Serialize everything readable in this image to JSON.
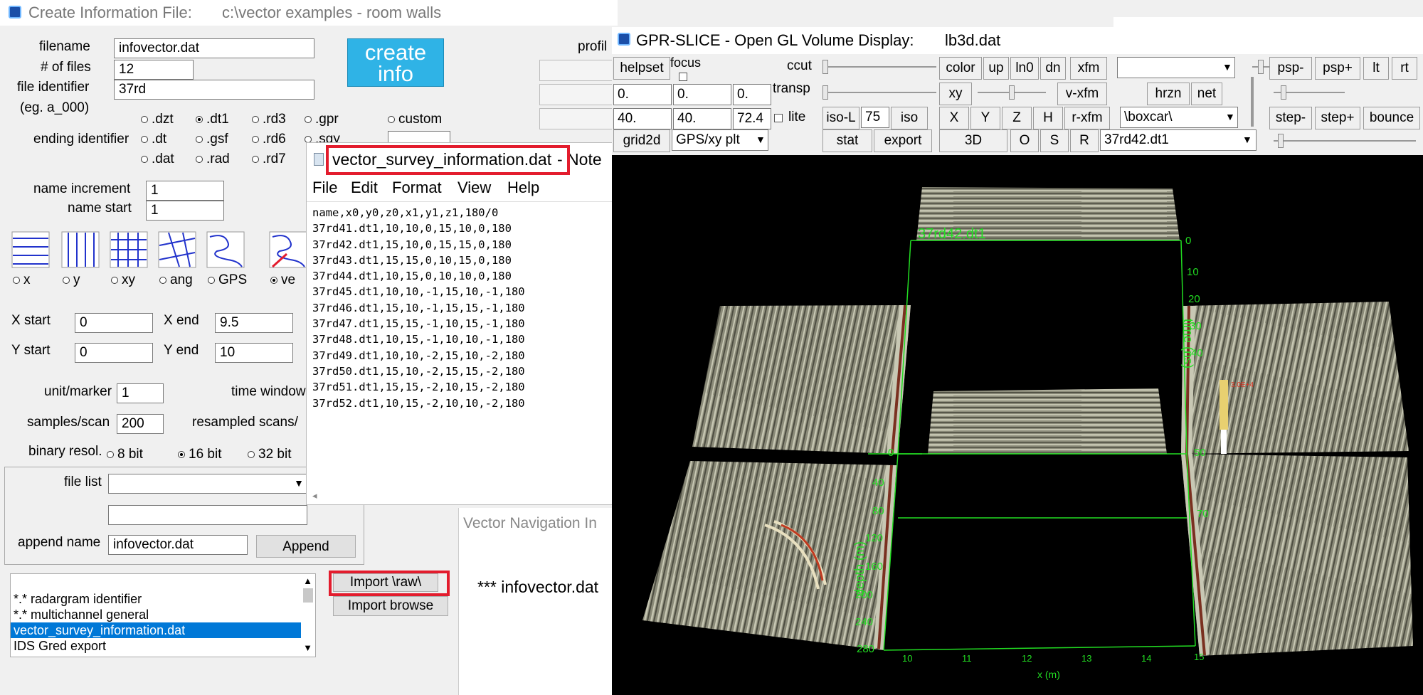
{
  "left_window": {
    "title": "Create Information File:",
    "title_path": "c:\\vector examples - room walls",
    "filename_label": "filename",
    "filename_value": "infovector.dat",
    "num_files_label": "# of files",
    "num_files_value": "12",
    "file_identifier_label": "file identifier",
    "file_identifier_value": "37rd",
    "eg_label": "(eg. a_000)",
    "create_info_label_1": "create",
    "create_info_label_2": "info",
    "profile_label": "profil",
    "ending_identifier_label": "ending identifier",
    "ext_row1": [
      ".dzt",
      ".dt1",
      ".rd3",
      ".gpr",
      "custom"
    ],
    "ext_row2": [
      ".dt",
      ".gsf",
      ".rd6",
      ".sgy"
    ],
    "ext_row3": [
      ".dat",
      ".rad",
      ".rd7"
    ],
    "name_increment_label": "name increment",
    "name_increment_value": "1",
    "name_start_label": "name start",
    "name_start_value": "1",
    "grid_options": [
      "x",
      "y",
      "xy",
      "ang",
      "GPS",
      "ve"
    ],
    "x_start_label": "X start",
    "x_start_value": "0",
    "x_end_label": "X end",
    "x_end_value": "9.5",
    "y_start_label": "Y start",
    "y_start_value": "0",
    "y_end_label": "Y end",
    "y_end_value": "10",
    "unit_marker_label": "unit/marker",
    "unit_marker_value": "1",
    "time_window_label": "time window",
    "samples_scan_label": "samples/scan",
    "samples_scan_value": "200",
    "resampled_label": "resampled scans/",
    "binary_resol_label": "binary resol.",
    "binary_options": [
      "8 bit",
      "16 bit",
      "32 bit"
    ],
    "file_list_label": "file list",
    "append_name_label": "append name",
    "append_name_value": "infovector.dat",
    "append_button": "Append",
    "import_raw_button": "Import \\raw\\",
    "import_browse_button": "Import browse",
    "list_items": [
      "*.* radargram identifier",
      "*.* multichannel general",
      "vector_survey_information.dat",
      "IDS Gred export"
    ],
    "selected_list_index": 2,
    "vector_nav_title": "Vector Navigation In",
    "vector_nav_text": "*** infovector.dat"
  },
  "notepad": {
    "title": "vector_survey_information.dat",
    "title_suffix": "- Note",
    "menu": [
      "File",
      "Edit",
      "Format",
      "View",
      "Help"
    ],
    "lines": [
      "name,x0,y0,z0,x1,y1,z1,180/0",
      "37rd41.dt1,10,10,0,15,10,0,180",
      "37rd42.dt1,15,10,0,15,15,0,180",
      "37rd43.dt1,15,15,0,10,15,0,180",
      "37rd44.dt1,10,15,0,10,10,0,180",
      "37rd45.dt1,10,10,-1,15,10,-1,180",
      "37rd46.dt1,15,10,-1,15,15,-1,180",
      "37rd47.dt1,15,15,-1,10,15,-1,180",
      "37rd48.dt1,10,15,-1,10,10,-1,180",
      "37rd49.dt1,10,10,-2,15,10,-2,180",
      "37rd50.dt1,15,10,-2,15,15,-2,180",
      "37rd51.dt1,15,15,-2,10,15,-2,180",
      "37rd52.dt1,10,15,-2,10,10,-2,180"
    ]
  },
  "gpr_window": {
    "title": "GPR-SLICE -  Open GL Volume Display:",
    "title_file": "lb3d.dat",
    "helpset": "helpset",
    "focus": "focus",
    "ccut": "ccut",
    "transp": "transp",
    "lite": "lite",
    "field_a1": "0.",
    "field_a2": "0.",
    "field_a3": "0.",
    "field_b1": "40.",
    "field_b2": "40.",
    "field_b3": "72.4",
    "grid2d": "grid2d",
    "gps_select": "GPS/xy plt",
    "iso_l": "iso-L",
    "iso_value": "75",
    "iso": "iso",
    "stat": "stat",
    "export": "export",
    "color": "color",
    "up": "up",
    "ln0": "ln0",
    "dn": "dn",
    "xfm": "xfm",
    "xy": "xy",
    "v_xfm": "v-xfm",
    "r_xfm": "r-xfm",
    "hrzn": "hrzn",
    "net": "net",
    "axis_x": "X",
    "axis_y": "Y",
    "axis_z": "Z",
    "axis_h": "H",
    "btn_3d": "3D",
    "btn_o": "O",
    "btn_s": "S",
    "btn_r": "R",
    "top_select": "",
    "boxcar_select": "\\boxcar\\",
    "file_select": "37rd42.dt1",
    "psp_minus": "psp-",
    "psp_plus": "psp+",
    "lt": "lt",
    "rt": "rt",
    "step_minus": "step-",
    "step_plus": "step+",
    "bounce": "bounce"
  },
  "viewport": {
    "label_file": "37rd42.dt1",
    "time_axis_label": "time (ns)",
    "depth_axis_label": "depth (m)",
    "x_axis_label": "x (m)",
    "time_ticks": [
      "0",
      "10",
      "20",
      "30",
      "40",
      "50",
      "70"
    ],
    "depth_ticks": [
      "0",
      "40",
      "80",
      "120",
      "160",
      "200",
      "240",
      "280"
    ],
    "x_ticks": [
      "10",
      "11",
      "12",
      "13",
      "14",
      "15"
    ],
    "colorbar_label": "3.0E+4"
  },
  "colors": {
    "highlight": "#e31c2d",
    "selection": "#0078d7",
    "create_button": "#2fb3e6",
    "axis_green": "#22dd22"
  }
}
